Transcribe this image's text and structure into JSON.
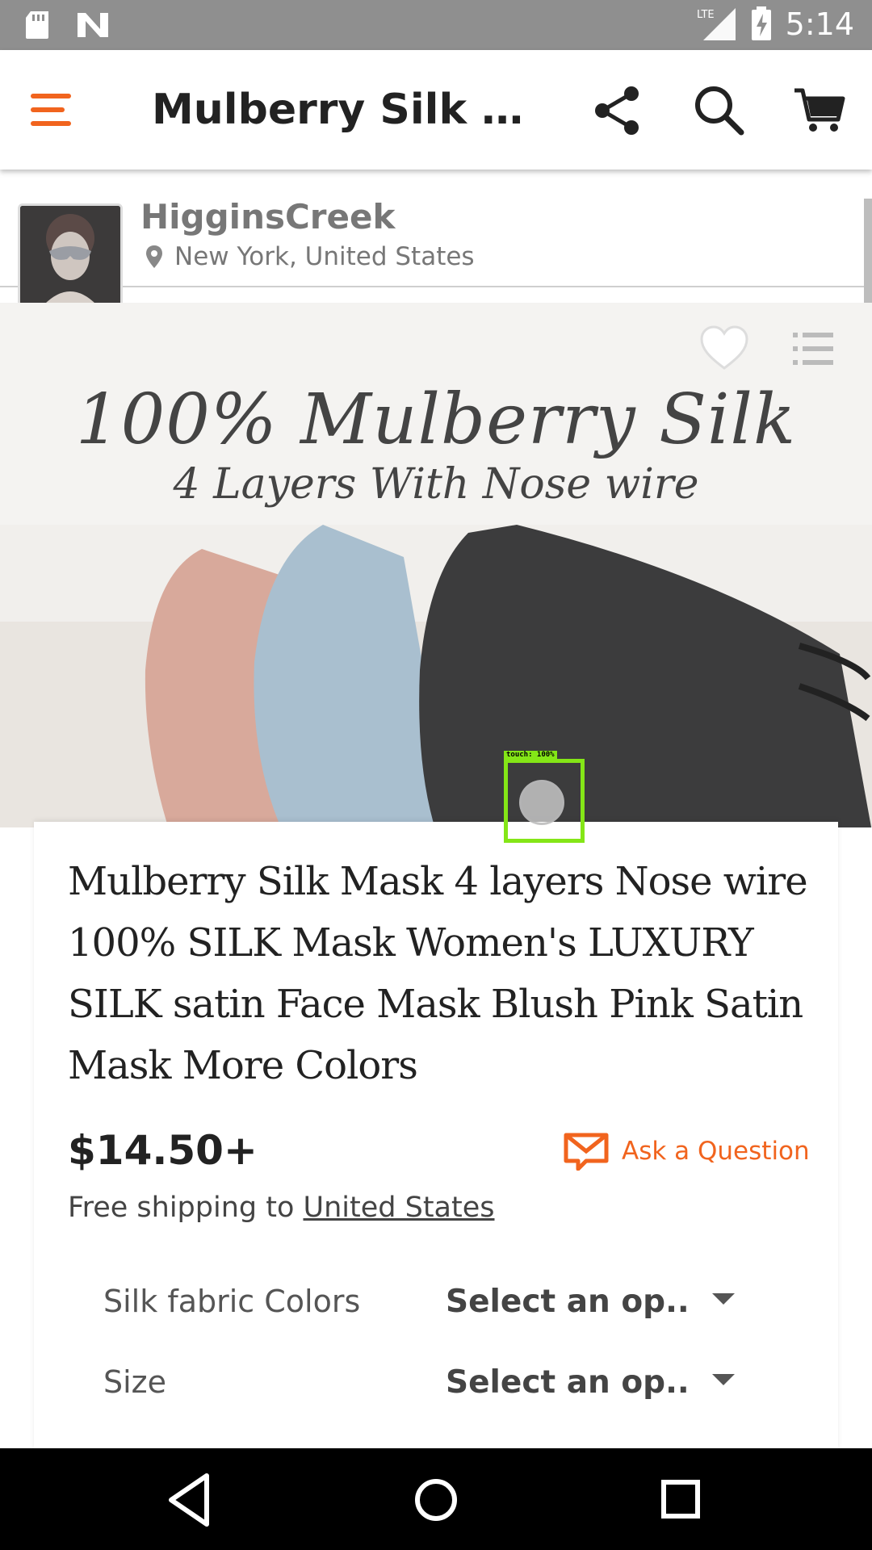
{
  "status_bar": {
    "time": "5:14",
    "network": "LTE"
  },
  "app_bar": {
    "title": "Mulberry Silk Mas...",
    "accent_color": "#f1641e"
  },
  "shop": {
    "name": "HigginsCreek",
    "location": "New York, United States"
  },
  "image": {
    "headline": "100% Mulberry Silk",
    "subline": "4 Layers With Nose wire"
  },
  "touch": {
    "label": "touch: 100%"
  },
  "product": {
    "title": "Mulberry Silk Mask 4 layers Nose wire 100% SILK Mask Women's LUXURY SILK satin Face Mask Blush Pink Satin Mask More Colors",
    "price": "$14.50+",
    "ask_label": "Ask a Question",
    "shipping_prefix": "Free shipping to ",
    "shipping_destination": "United States"
  },
  "options": [
    {
      "label": "Silk fabric Colors",
      "value": "Select an op.."
    },
    {
      "label": "Size",
      "value": "Select an op.."
    }
  ]
}
